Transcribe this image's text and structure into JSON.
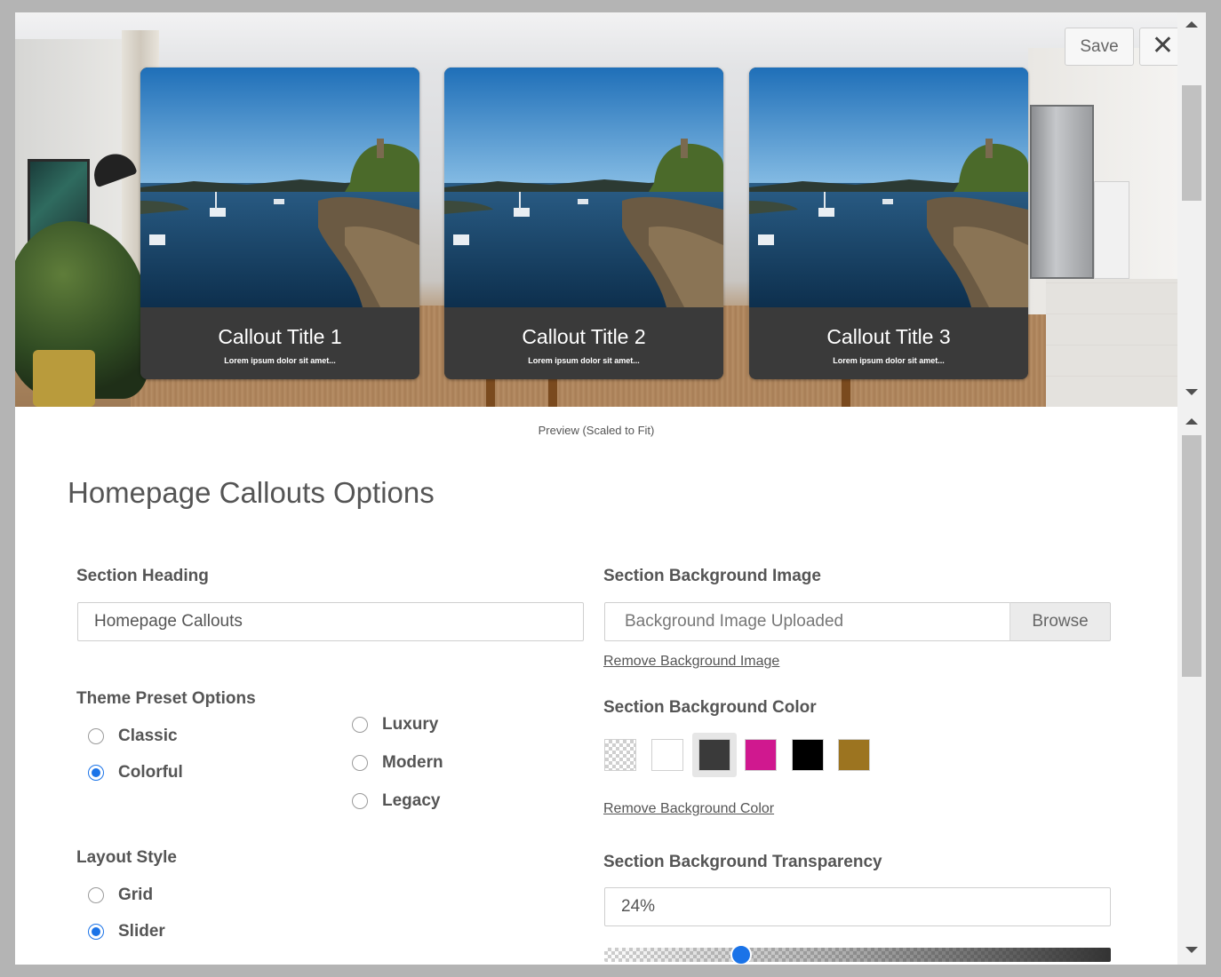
{
  "toolbar": {
    "save_label": "Save",
    "close_glyph": "✕",
    "close_icon": "close-icon"
  },
  "preview": {
    "caption": "Preview (Scaled to Fit)",
    "cards": [
      {
        "title": "Callout Title 1",
        "text": "Lorem ipsum dolor sit amet..."
      },
      {
        "title": "Callout Title 2",
        "text": "Lorem ipsum dolor sit amet..."
      },
      {
        "title": "Callout Title 3",
        "text": "Lorem ipsum dolor sit amet..."
      }
    ]
  },
  "panel": {
    "title": "Homepage Callouts Options",
    "section_heading": {
      "label": "Section Heading",
      "value": "Homepage Callouts"
    },
    "background_image": {
      "label": "Section Background Image",
      "value": "Background Image Uploaded",
      "browse_label": "Browse",
      "remove_link": "Remove Background Image"
    },
    "theme_preset": {
      "label": "Theme Preset Options",
      "options": [
        {
          "label": "Classic",
          "selected": false
        },
        {
          "label": "Colorful",
          "selected": true
        },
        {
          "label": "Luxury",
          "selected": false
        },
        {
          "label": "Modern",
          "selected": false
        },
        {
          "label": "Legacy",
          "selected": false
        }
      ]
    },
    "background_color": {
      "label": "Section Background Color",
      "swatches": [
        {
          "name": "transparent",
          "color": "transparent"
        },
        {
          "name": "white",
          "color": "#ffffff"
        },
        {
          "name": "charcoal",
          "color": "#3a3a3a",
          "selected": true
        },
        {
          "name": "magenta",
          "color": "#d0188f"
        },
        {
          "name": "black",
          "color": "#000000"
        },
        {
          "name": "gold",
          "color": "#9c7420"
        }
      ],
      "remove_link": "Remove Background Color"
    },
    "layout_style": {
      "label": "Layout Style",
      "options": [
        {
          "label": "Grid",
          "selected": false
        },
        {
          "label": "Slider",
          "selected": true
        }
      ]
    },
    "transparency": {
      "label": "Section Background Transparency",
      "value": "24%",
      "fraction": 0.27
    }
  },
  "colors": {
    "accent": "#1a73e8",
    "card_bg": "#3a3a3a"
  }
}
